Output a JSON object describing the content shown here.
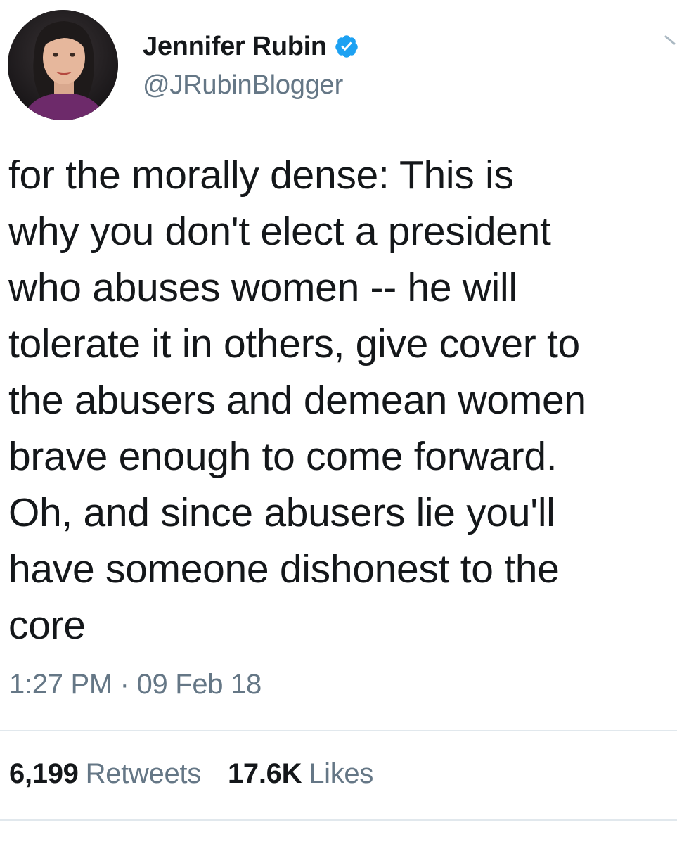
{
  "author": {
    "display_name": "Jennifer Rubin",
    "handle": "@JRubinBlogger",
    "verified": true,
    "avatar_icon": "profile-photo"
  },
  "tweet": {
    "text": "for the morally dense: This is\nwhy you don't elect a president\nwho abuses women -- he will\ntolerate it in others, give cover to\nthe abusers and demean women\nbrave enough to come forward.\nOh, and since abusers lie you'll\nhave someone dishonest to the\ncore",
    "timestamp": "1:27 PM · 09 Feb 18"
  },
  "stats": {
    "retweets_count": "6,199",
    "retweets_label": "Retweets",
    "likes_count": "17.6K",
    "likes_label": "Likes"
  },
  "colors": {
    "text": "#14171a",
    "secondary": "#657786",
    "verified_blue": "#1da1f2",
    "divider": "#e1e8ed"
  }
}
